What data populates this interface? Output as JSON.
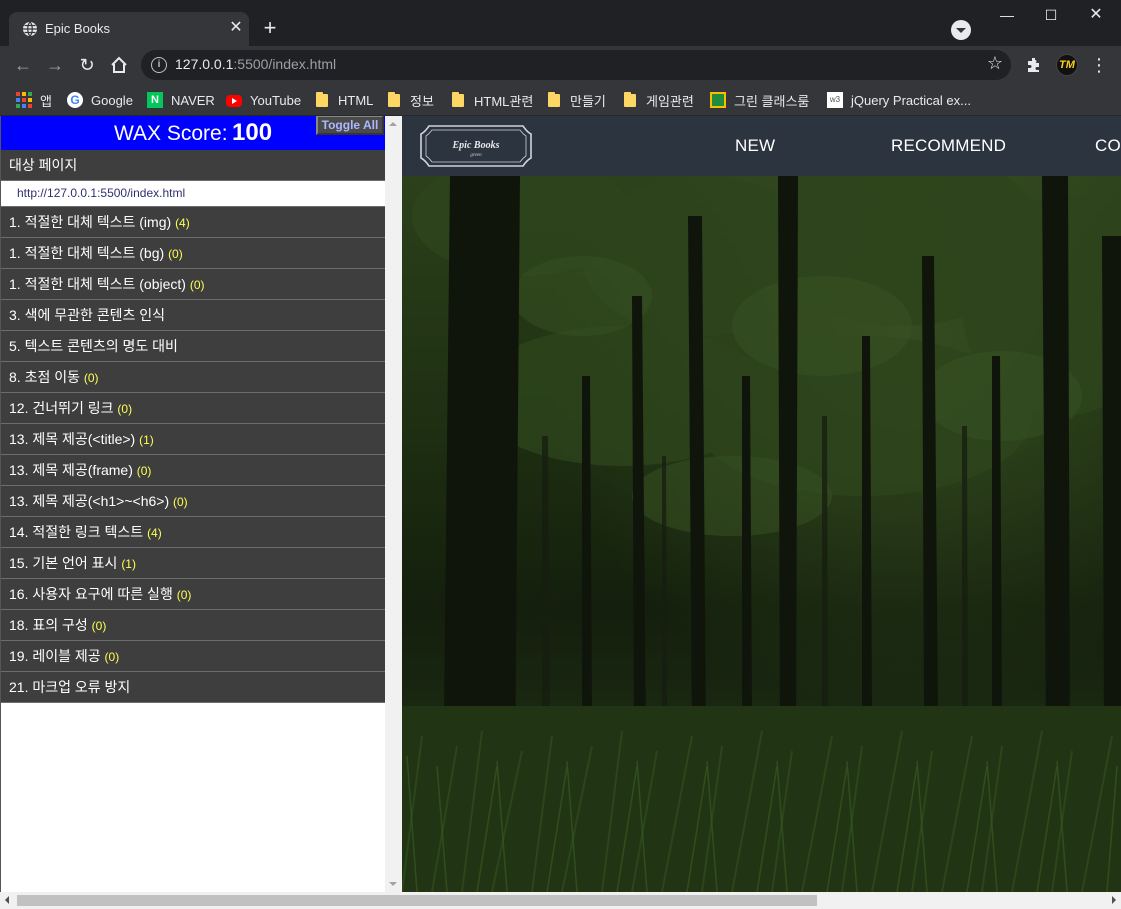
{
  "browser": {
    "tab_title": "Epic Books",
    "url_host": "127.0.0.1",
    "url_rest": ":5500/index.html",
    "window_controls": [
      "minimize-icon",
      "maximize-icon",
      "close-icon"
    ],
    "bookmarks": [
      {
        "label": "앱",
        "icon": "apps-icon"
      },
      {
        "label": "Google",
        "icon": "google-icon"
      },
      {
        "label": "NAVER",
        "icon": "naver-icon"
      },
      {
        "label": "YouTube",
        "icon": "youtube-icon"
      },
      {
        "label": "HTML",
        "icon": "folder-icon"
      },
      {
        "label": "정보",
        "icon": "folder-icon"
      },
      {
        "label": "HTML관련",
        "icon": "folder-icon"
      },
      {
        "label": "만들기",
        "icon": "folder-icon"
      },
      {
        "label": "게임관련",
        "icon": "folder-icon"
      },
      {
        "label": "그린 클래스룸",
        "icon": "classroom-icon"
      },
      {
        "label": "jQuery Practical ex...",
        "icon": "w3schools-icon"
      }
    ]
  },
  "wax": {
    "score_label": "WAX Score:",
    "score_value": "100",
    "toggle_label": "Toggle All",
    "target_heading": "대상 페이지",
    "target_url": "http://127.0.0.1:5500/index.html",
    "items": [
      {
        "label": "1. 적절한 대체 텍스트 (img)",
        "count": "(4)"
      },
      {
        "label": "1. 적절한 대체 텍스트 (bg)",
        "count": "(0)"
      },
      {
        "label": "1. 적절한 대체 텍스트 (object)",
        "count": "(0)"
      },
      {
        "label": "3. 색에 무관한 콘텐츠 인식",
        "count": ""
      },
      {
        "label": "5. 텍스트 콘텐츠의 명도 대비",
        "count": ""
      },
      {
        "label": "8. 초점 이동",
        "count": "(0)"
      },
      {
        "label": "12. 건너뛰기 링크",
        "count": "(0)"
      },
      {
        "label": "13. 제목 제공(<title>)",
        "count": "(1)"
      },
      {
        "label": "13. 제목 제공(frame)",
        "count": "(0)"
      },
      {
        "label": "13. 제목 제공(<h1>~<h6>)",
        "count": "(0)"
      },
      {
        "label": "14. 적절한 링크 텍스트",
        "count": "(4)"
      },
      {
        "label": "15. 기본 언어 표시",
        "count": "(1)"
      },
      {
        "label": "16. 사용자 요구에 따른 실행",
        "count": "(0)"
      },
      {
        "label": "18. 표의 구성",
        "count": "(0)"
      },
      {
        "label": "19. 레이블 제공",
        "count": "(0)"
      },
      {
        "label": "21. 마크업 오류 방지",
        "count": ""
      }
    ]
  },
  "site": {
    "logo_title": "Epic Books",
    "logo_sub": "green",
    "nav": [
      "NEW",
      "RECOMMEND",
      "CON"
    ]
  },
  "colors": {
    "wax_header": "#0000ff",
    "wax_row": "#3e3e3e",
    "site_header": "#2c3440",
    "count_highlight": "#ffff55"
  }
}
